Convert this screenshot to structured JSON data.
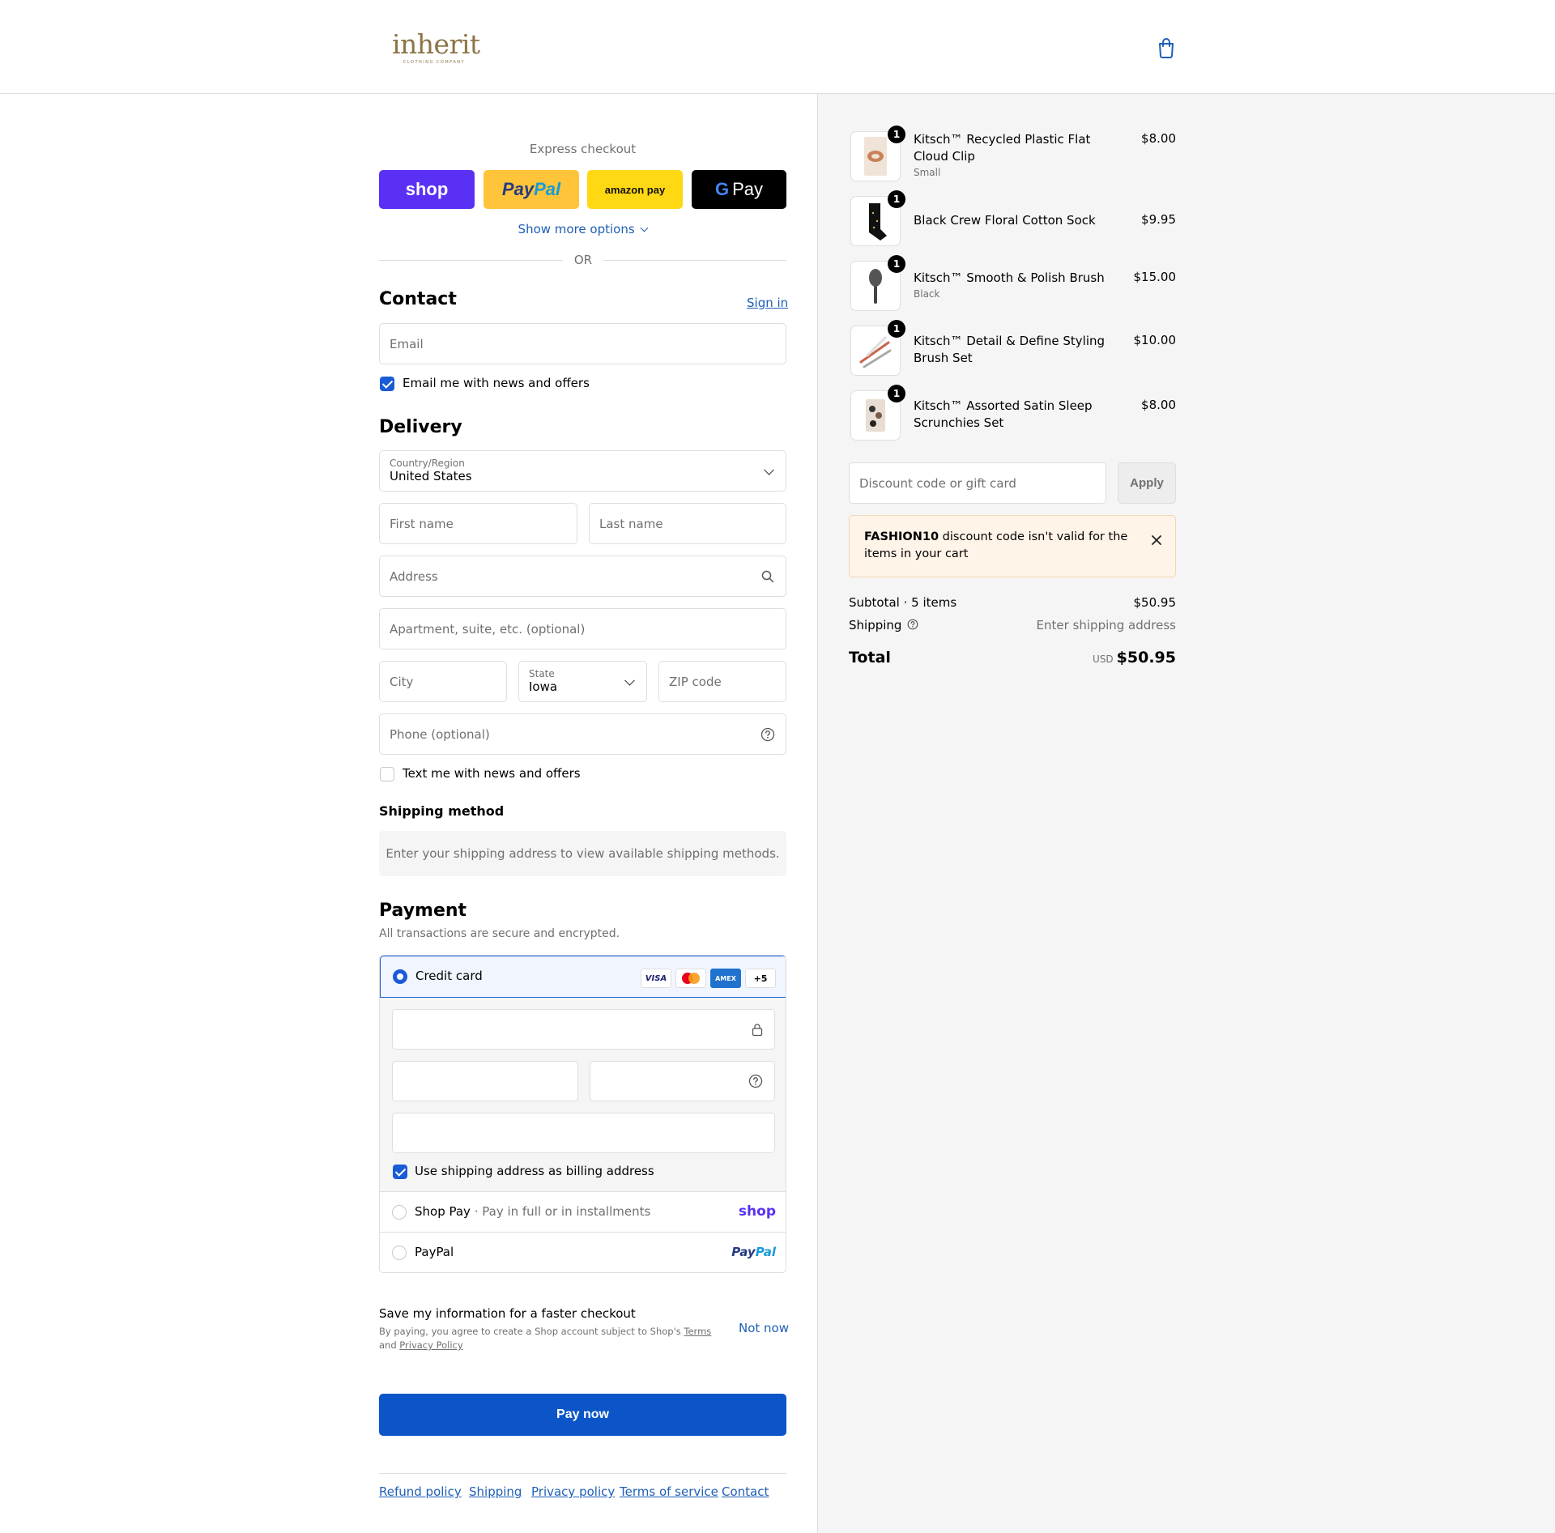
{
  "header": {
    "logo_text": "inherit",
    "logo_sub": "CLOTHING COMPANY",
    "cart_icon": "shopping-bag-icon"
  },
  "express": {
    "title": "Express checkout",
    "shop_label": "shop",
    "paypal_pay": "Pay",
    "paypal_pal": "Pal",
    "amazon_label": "amazon pay",
    "gpay_g": "G",
    "gpay_label": "Pay",
    "more_options": "Show more options",
    "or": "OR"
  },
  "contact": {
    "title": "Contact",
    "sign_in": "Sign in",
    "email_placeholder": "Email",
    "news_label": "Email me with news and offers",
    "news_checked": true
  },
  "delivery": {
    "title": "Delivery",
    "country_label": "Country/Region",
    "country_value": "United States",
    "first_name": "First name",
    "last_name": "Last name",
    "address": "Address",
    "apartment": "Apartment, suite, etc. (optional)",
    "city": "City",
    "state_label": "State",
    "state_value": "Iowa",
    "zip": "ZIP code",
    "phone": "Phone (optional)",
    "text_label": "Text me with news and offers",
    "text_checked": false
  },
  "shipping_method": {
    "title": "Shipping method",
    "message": "Enter your shipping address to view available shipping methods."
  },
  "payment": {
    "title": "Payment",
    "subtitle": "All transactions are secure and encrypted.",
    "credit_card": "Credit card",
    "cards": [
      "VISA",
      "MC",
      "AMEX",
      "+5"
    ],
    "billing_label": "Use shipping address as billing address",
    "billing_checked": true,
    "shop_pay": "Shop Pay",
    "shop_pay_sub": "· Pay in full or in installments",
    "shop_pay_logo": "shop",
    "paypal": "PayPal",
    "paypal_logo_pay": "Pay",
    "paypal_logo_pal": "Pal"
  },
  "save_info": {
    "title": "Save my information for a faster checkout",
    "legal_prefix": "By paying, you agree to create a Shop account subject to Shop's",
    "terms": "Terms",
    "and": "and",
    "privacy": "Privacy Policy",
    "not_now": "Not now"
  },
  "pay_now": "Pay now",
  "footer": [
    "Refund policy",
    "Shipping",
    "Privacy policy",
    "Terms of service",
    "Contact"
  ],
  "cart": {
    "items": [
      {
        "name": "Kitsch™ Recycled Plastic Flat Cloud Clip",
        "variant": "Small",
        "price": "$8.00",
        "qty": "1"
      },
      {
        "name": "Black Crew Floral Cotton Sock",
        "variant": "",
        "price": "$9.95",
        "qty": "1"
      },
      {
        "name": "Kitsch™ Smooth & Polish Brush",
        "variant": "Black",
        "price": "$15.00",
        "qty": "1"
      },
      {
        "name": "Kitsch™ Detail & Define Styling Brush Set",
        "variant": "",
        "price": "$10.00",
        "qty": "1"
      },
      {
        "name": "Kitsch™ Assorted Satin Sleep Scrunchies Set",
        "variant": "",
        "price": "$8.00",
        "qty": "1"
      }
    ],
    "discount_placeholder": "Discount code or gift card",
    "apply": "Apply",
    "alert_code": "FASHION10",
    "alert_msg": " discount code isn't valid for the items in your cart",
    "subtotal_label": "Subtotal · 5 items",
    "subtotal_value": "$50.95",
    "shipping_label": "Shipping",
    "shipping_value": "Enter shipping address",
    "total_label": "Total",
    "currency": "USD",
    "total_value": "$50.95"
  },
  "colors": {
    "accent": "#1a5bd6",
    "pay_button": "#0b55c8",
    "shop_purple": "#5a31f4",
    "paypal_yellow": "#ffc439",
    "amazon_yellow": "#ffd814",
    "logo_gold": "#8c7547"
  }
}
